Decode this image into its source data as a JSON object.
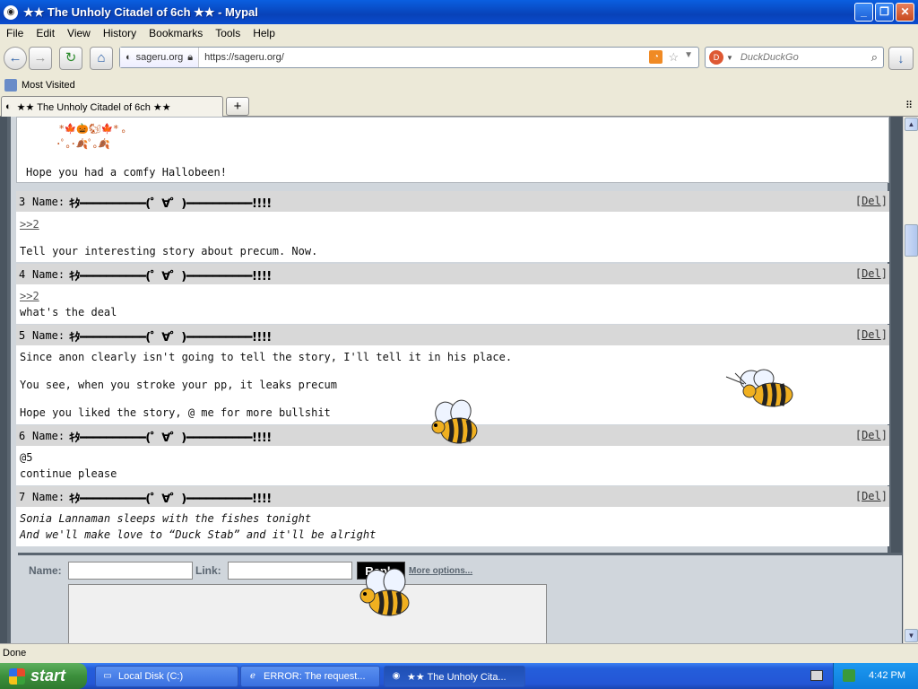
{
  "window": {
    "title": "★★ The Unholy Citadel of 6ch ★★ - Mypal",
    "minimize": "_",
    "maximize": "❐",
    "close": "✕"
  },
  "menu": [
    "File",
    "Edit",
    "View",
    "History",
    "Bookmarks",
    "Tools",
    "Help"
  ],
  "nav": {
    "back": "←",
    "forward": "→",
    "reload": "↻",
    "home": "⌂",
    "site_identity": "sageru.org",
    "url": "https://sageru.org/",
    "search_engine": "DuckDuckGo",
    "search_placeholder": "DuckDuckGo",
    "download": "↓"
  },
  "bookmarks": {
    "most_visited": "Most Visited"
  },
  "tabs": [
    {
      "label": "★★ The Unholy Citadel of 6ch ★★"
    }
  ],
  "new_tab": "+",
  "page": {
    "prev_post": {
      "art_line1": "  *🍁🎃🐿🍁* 。",
      "art_line2": " ･ﾟ｡･🍂ﾟ｡🍂",
      "text": "Hope you had a comfy Hallobeen!"
    },
    "posts": [
      {
        "num": "3",
        "name_label": "Name:",
        "name": "ｷﾀ━━━━━━━━━━(゜∀゜)━━━━━━━━━━!!!!",
        "del": "Del",
        "lines": [
          {
            "text": ">>2",
            "style": "link"
          },
          {
            "text": "",
            "style": ""
          },
          {
            "text": "Tell your interesting story about precum. Now.",
            "style": ""
          }
        ]
      },
      {
        "num": "4",
        "name_label": "Name:",
        "name": "ｷﾀ━━━━━━━━━━(゜∀゜)━━━━━━━━━━!!!!",
        "del": "Del",
        "lines": [
          {
            "text": ">>2",
            "style": "link"
          },
          {
            "text": "what's the deal",
            "style": ""
          }
        ]
      },
      {
        "num": "5",
        "name_label": "Name:",
        "name": "ｷﾀ━━━━━━━━━━(゜∀゜)━━━━━━━━━━!!!!",
        "del": "Del",
        "lines": [
          {
            "text": "Since anon clearly isn't going to tell the story, I'll tell it in his place.",
            "style": ""
          },
          {
            "text": "",
            "style": ""
          },
          {
            "text": "You see, when you stroke your pp, it leaks precum",
            "style": ""
          },
          {
            "text": "",
            "style": ""
          },
          {
            "text": "Hope you liked the story, @ me for more bullshit",
            "style": ""
          }
        ]
      },
      {
        "num": "6",
        "name_label": "Name:",
        "name": "ｷﾀ━━━━━━━━━━(゜∀゜)━━━━━━━━━━!!!!",
        "del": "Del",
        "lines": [
          {
            "text": "@5",
            "style": ""
          },
          {
            "text": "continue please",
            "style": ""
          }
        ]
      },
      {
        "num": "7",
        "name_label": "Name:",
        "name": "ｷﾀ━━━━━━━━━━(゜∀゜)━━━━━━━━━━!!!!",
        "del": "Del",
        "lines": [
          {
            "text": "Sonia Lannaman sleeps with the fishes tonight",
            "style": "it"
          },
          {
            "text": "And we'll make love to “Duck Stab” and it'll be alright",
            "style": "it"
          }
        ]
      }
    ],
    "reply_form": {
      "name_label": "Name:",
      "link_label": "Link:",
      "reply_button": "Reply",
      "more_options": "More options..."
    }
  },
  "status": "Done",
  "taskbar": {
    "start": "start",
    "tasks": [
      "Local Disk (C:)",
      "ERROR: The request...",
      "★★ The Unholy Cita..."
    ],
    "clock": "4:42 PM"
  }
}
